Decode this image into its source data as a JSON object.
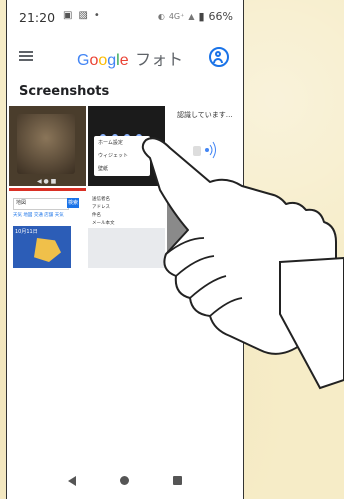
{
  "status": {
    "time": "21:20",
    "battery": "66%",
    "network": "4G⁺"
  },
  "appbar": {
    "title_letters": [
      "G",
      "o",
      "o",
      "g",
      "l",
      "e"
    ],
    "title_suffix": "フォト"
  },
  "section": {
    "title": "Screenshots"
  },
  "thumbs": {
    "t2_menu": [
      "ホーム設定",
      "ウィジェット",
      "壁紙"
    ],
    "t3_header": "認識しています…",
    "t4_search": "地図",
    "t4_search_btn": "検索",
    "t4_tabs": "天気 地図 交通 店舗 天気",
    "t4_map_title": "10月11日",
    "t5_lines": [
      "送信者名",
      "アドレス",
      "件名",
      "メール本文"
    ]
  },
  "colors": {
    "google_blue": "#4285F4",
    "google_red": "#EA4335",
    "google_yellow": "#FBBC05",
    "google_green": "#34A853",
    "background": "#f6ecc7"
  },
  "icons": {
    "menu": "hamburger-menu-icon",
    "account": "account-circle-icon",
    "back": "back-triangle-icon",
    "home": "home-circle-icon",
    "recent": "recent-square-icon"
  }
}
